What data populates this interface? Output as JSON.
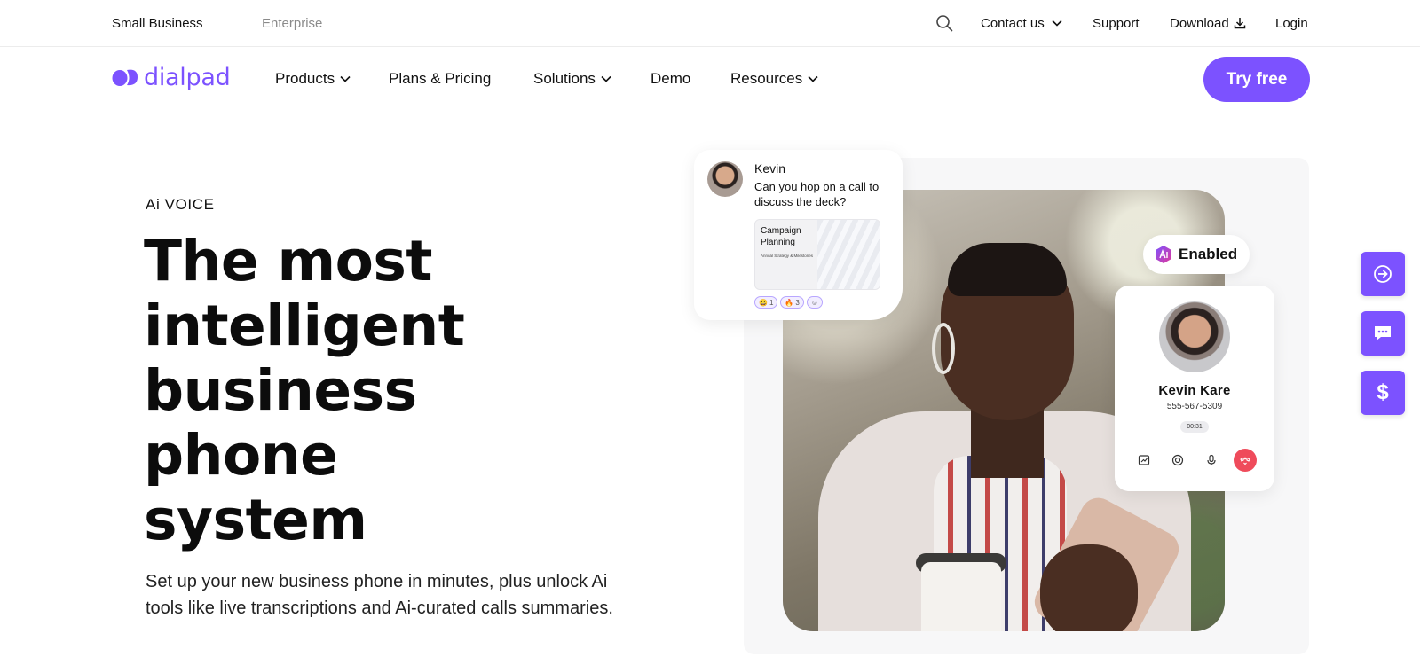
{
  "topbar": {
    "segments": [
      "Small Business",
      "Enterprise"
    ],
    "search_icon": "search-icon",
    "contact": "Contact us",
    "support": "Support",
    "download": "Download",
    "login": "Login"
  },
  "nav": {
    "logo_text": "dialpad",
    "items": [
      "Products",
      "Plans & Pricing",
      "Solutions",
      "Demo",
      "Resources"
    ],
    "cta": "Try free"
  },
  "hero": {
    "eyebrow": "Ai VOICE",
    "title_lines": [
      "The most",
      "intelligent",
      "business",
      "phone",
      "system"
    ],
    "subtitle": "Set up your new business phone in minutes, plus unlock Ai tools like live transcriptions and Ai-curated calls summaries."
  },
  "chat_card": {
    "name": "Kevin",
    "message": "Can you hop on a call to discuss the deck?",
    "doc_title": "Campaign Planning",
    "doc_meta": "Annual Strategy & Milestones",
    "reactions": [
      {
        "emoji": "😀",
        "count": "1"
      },
      {
        "emoji": "🔥",
        "count": "3"
      },
      {
        "emoji": "☺",
        "count": ""
      }
    ]
  },
  "enabled_badge": {
    "label": "Enabled"
  },
  "call_card": {
    "name": "Kevin Kare",
    "number": "555-567-5309",
    "timer": "00:31"
  },
  "fabs": {
    "dollar": "$"
  },
  "colors": {
    "brand": "#7c52ff",
    "end_call": "#ef4b5b"
  }
}
